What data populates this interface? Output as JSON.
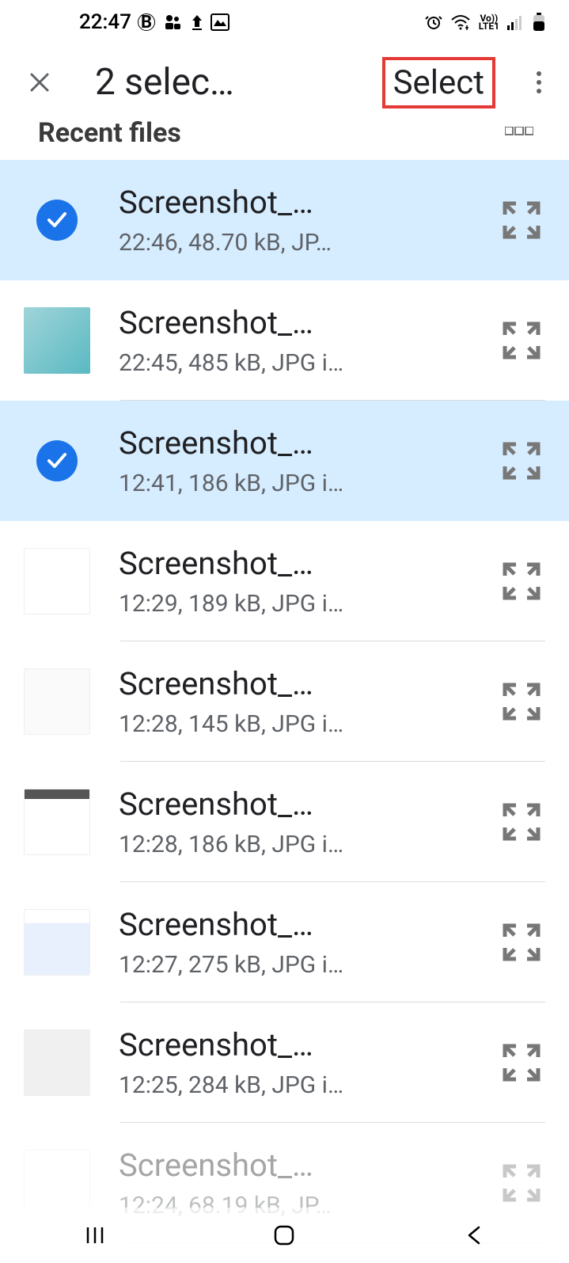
{
  "status_bar": {
    "time": "22:47",
    "lte_label": "LTE1"
  },
  "header": {
    "title": "2 selec…",
    "select_label": "Select"
  },
  "section_label": "Recent files",
  "files": [
    {
      "selected": true,
      "name": "Screenshot_…",
      "meta": "22:46, 48.70 kB, JP…",
      "thumb": "check"
    },
    {
      "selected": false,
      "name": "Screenshot_…",
      "meta": "22:45, 485 kB, JPG i…",
      "thumb": "pool"
    },
    {
      "selected": true,
      "name": "Screenshot_…",
      "meta": "12:41, 186 kB, JPG i…",
      "thumb": "check"
    },
    {
      "selected": false,
      "name": "Screenshot_…",
      "meta": "12:29, 189 kB, JPG i…",
      "thumb": "white"
    },
    {
      "selected": false,
      "name": "Screenshot_…",
      "meta": "12:28, 145 kB, JPG i…",
      "thumb": "white2"
    },
    {
      "selected": false,
      "name": "Screenshot_…",
      "meta": "12:28, 186 kB, JPG i…",
      "thumb": "darkbar"
    },
    {
      "selected": false,
      "name": "Screenshot_…",
      "meta": "12:27, 275 kB, JPG i…",
      "thumb": "app"
    },
    {
      "selected": false,
      "name": "Screenshot_…",
      "meta": "12:25, 284 kB, JPG i…",
      "thumb": "gallery"
    },
    {
      "selected": false,
      "name": "Screenshot_…",
      "meta": "12:24, 68.19 kB, JP…",
      "thumb": "white",
      "faded": true
    }
  ]
}
